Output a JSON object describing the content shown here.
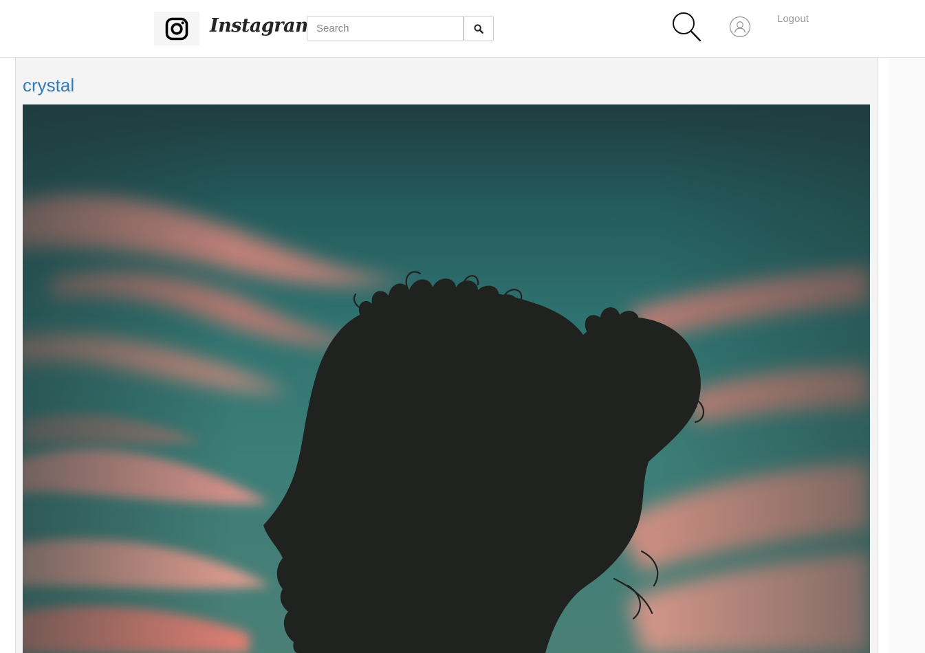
{
  "navbar": {
    "brand_name": "Instagram",
    "search": {
      "placeholder": "Search",
      "value": ""
    },
    "logout_label": "Logout"
  },
  "post": {
    "username": "crystal",
    "image_subject": "silhouette of woman's profile against sunset sky"
  },
  "colors": {
    "link": "#337ab7",
    "sky_top": "#1f3f42",
    "sky_mid": "#2e7675",
    "cloud_pink": "#e88f82",
    "silhouette": "#202220"
  }
}
